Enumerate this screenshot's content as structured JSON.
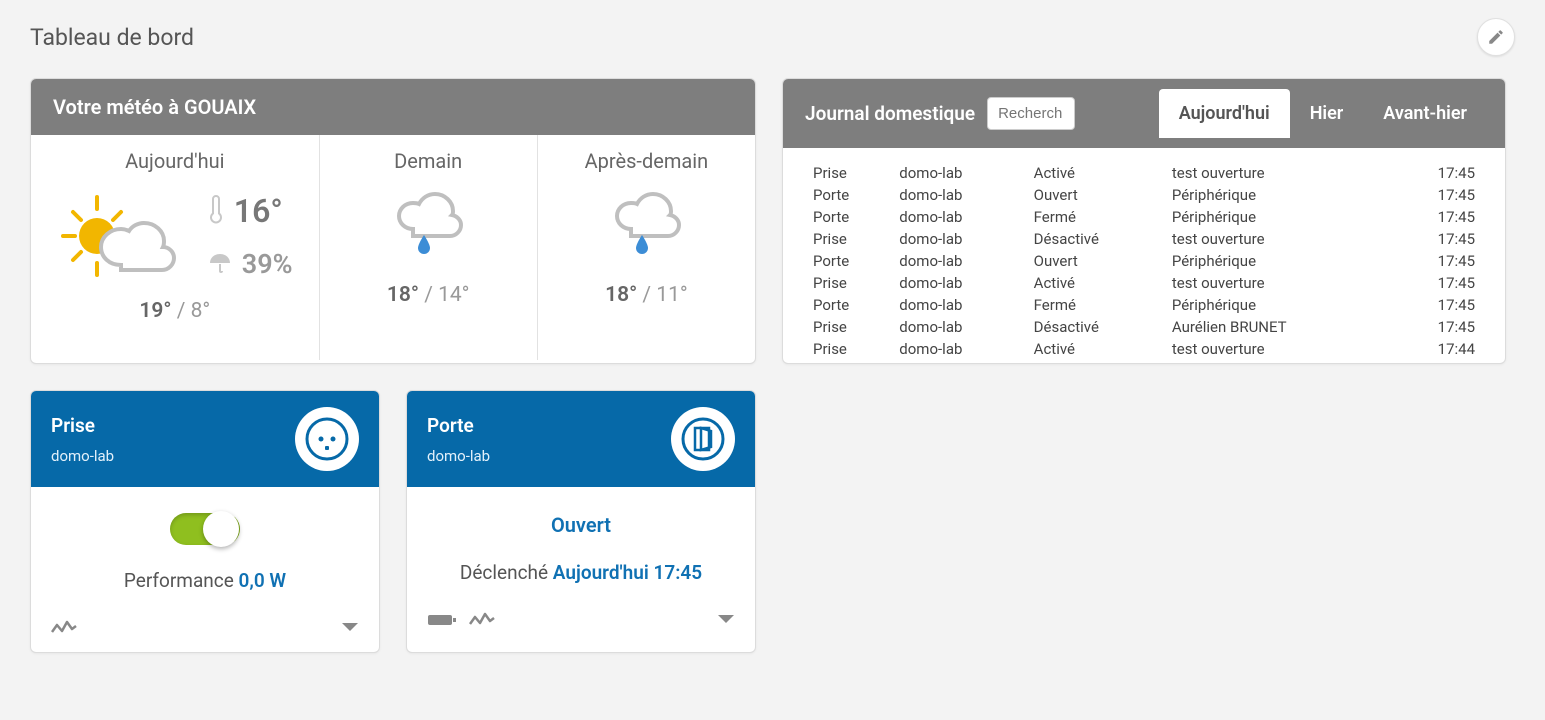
{
  "page_title": "Tableau de bord",
  "weather": {
    "title": "Votre météo à GOUAIX",
    "today": {
      "label": "Aujourd'hui",
      "current": "16°",
      "humidity": "39%",
      "hi": "19°",
      "lo": "8°"
    },
    "tomorrow": {
      "label": "Demain",
      "hi": "18°",
      "lo": "14°"
    },
    "day_after": {
      "label": "Après-demain",
      "hi": "18°",
      "lo": "11°"
    }
  },
  "log": {
    "title": "Journal domestique",
    "search_placeholder": "Recherch",
    "tabs": {
      "today": "Aujourd'hui",
      "yesterday": "Hier",
      "before": "Avant-hier"
    },
    "rows": [
      {
        "a": "Prise",
        "b": "domo-lab",
        "c": "Activé",
        "d": "test ouverture",
        "e": "17:45"
      },
      {
        "a": "Porte",
        "b": "domo-lab",
        "c": "Ouvert",
        "d": "Périphérique",
        "e": "17:45"
      },
      {
        "a": "Porte",
        "b": "domo-lab",
        "c": "Fermé",
        "d": "Périphérique",
        "e": "17:45"
      },
      {
        "a": "Prise",
        "b": "domo-lab",
        "c": "Désactivé",
        "d": "test ouverture",
        "e": "17:45"
      },
      {
        "a": "Porte",
        "b": "domo-lab",
        "c": "Ouvert",
        "d": "Périphérique",
        "e": "17:45"
      },
      {
        "a": "Prise",
        "b": "domo-lab",
        "c": "Activé",
        "d": "test ouverture",
        "e": "17:45"
      },
      {
        "a": "Porte",
        "b": "domo-lab",
        "c": "Fermé",
        "d": "Périphérique",
        "e": "17:45"
      },
      {
        "a": "Prise",
        "b": "domo-lab",
        "c": "Désactivé",
        "d": "Aurélien BRUNET",
        "e": "17:45"
      },
      {
        "a": "Prise",
        "b": "domo-lab",
        "c": "Activé",
        "d": "test ouverture",
        "e": "17:44"
      }
    ]
  },
  "devices": {
    "outlet": {
      "title": "Prise",
      "sub": "domo-lab",
      "perf_label": "Performance",
      "perf_value": "0,0 W"
    },
    "door": {
      "title": "Porte",
      "sub": "domo-lab",
      "state": "Ouvert",
      "trigger_label": "Déclenché",
      "trigger_value": "Aujourd'hui 17:45"
    }
  }
}
